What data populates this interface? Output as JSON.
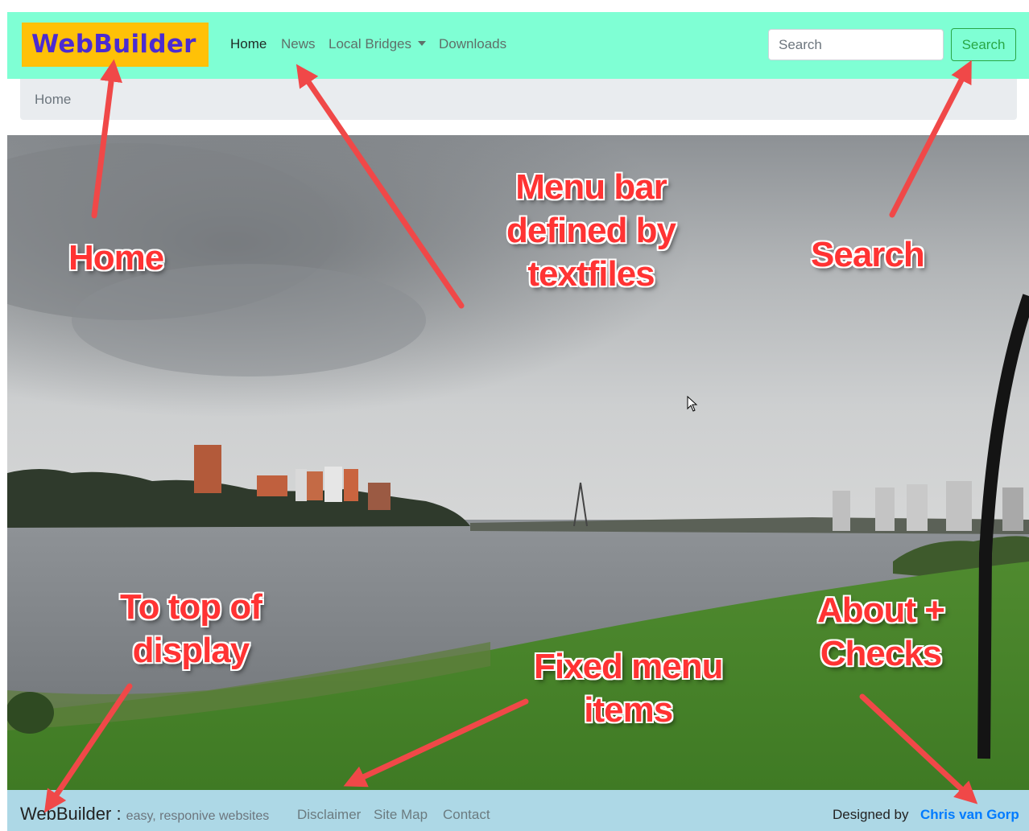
{
  "navbar": {
    "brand": "WebBuilder",
    "links": [
      "Home",
      "News",
      "Local Bridges",
      "Downloads"
    ],
    "search": {
      "placeholder": "Search",
      "value": "",
      "button_label": "Search"
    },
    "background": "#7fffd4",
    "brand_background": "#ffc107",
    "brand_color": "#4b2bd1"
  },
  "breadcrumb": {
    "items": [
      "Home"
    ]
  },
  "annotations": {
    "home": "Home",
    "menu_bar_line1": "Menu bar",
    "menu_bar_line2": "defined by",
    "menu_bar_line3": "textfiles",
    "search": "Search",
    "to_top_line1": "To top of",
    "to_top_line2": "display",
    "fixed_menu_line1": "Fixed menu",
    "fixed_menu_line2": "items",
    "about_line1": "About +",
    "about_line2": "Checks",
    "color": "#ff3333"
  },
  "footer": {
    "brand": "WebBuilder",
    "separator": " : ",
    "tagline": "easy, responive websites",
    "links": [
      "Disclaimer",
      "Site Map",
      "Contact"
    ],
    "designed_by": "Designed by",
    "author": "Chris van Gorp",
    "background": "#add8e6",
    "author_color": "#007bff"
  },
  "icons": [
    "mouse-pointer-icon",
    "dropdown-caret-icon"
  ]
}
